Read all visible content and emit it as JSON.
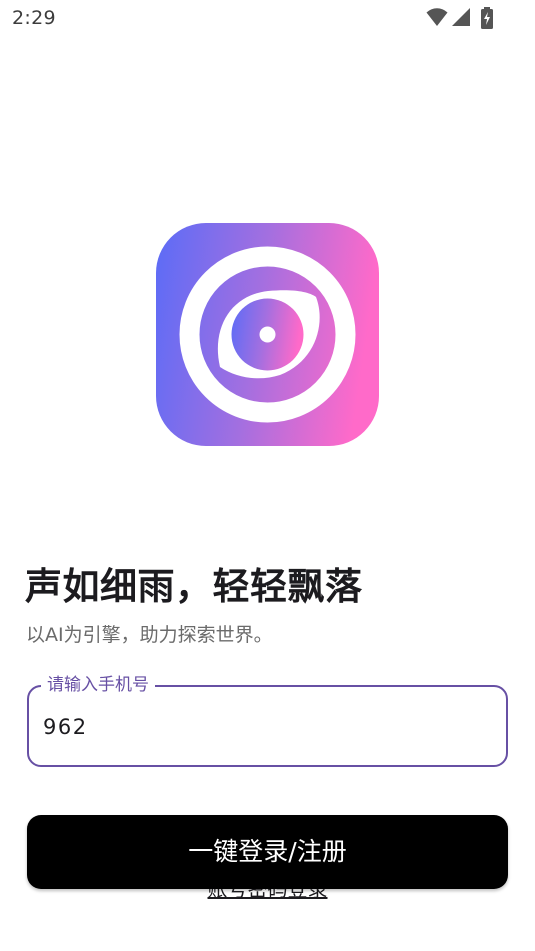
{
  "status_bar": {
    "time": "2:29",
    "icons": [
      "wifi-icon",
      "signal-icon",
      "battery-charging-icon"
    ]
  },
  "logo": {
    "icon": "eye-lens-logo-icon",
    "gradient_colors": [
      "#5b6cf7",
      "#a36fe0",
      "#ff6ac9"
    ]
  },
  "main": {
    "headline": "声如细雨，轻轻飘落",
    "subline": "以AI为引擎，助力探索世界。"
  },
  "phone_field": {
    "label": "请输入手机号",
    "value": "962"
  },
  "actions": {
    "login_button_label": "一键登录/注册",
    "password_login_label": "账号密码登录"
  },
  "colors": {
    "accent": "#6750a4",
    "button_bg": "#000000",
    "button_text": "#ffffff"
  }
}
